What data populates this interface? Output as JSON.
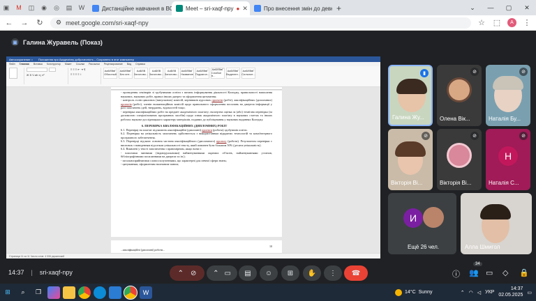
{
  "browser": {
    "tabs": [
      {
        "label": "Дистанційне навчання в ВСП",
        "favicon_color": "#4285f4"
      },
      {
        "label": "Meet – sri-xaqf-npy",
        "favicon_color": "#00897b",
        "active": true
      },
      {
        "label": "Про внесення змін до девки",
        "favicon_color": "#4285f4"
      }
    ],
    "url": "meet.google.com/sri-xaqf-npy",
    "profile_initial": "A"
  },
  "meet": {
    "presenter_label": "Галина Журавель (Показ)",
    "meeting_time": "14:37",
    "meeting_code": "sri-xaqf-npy",
    "participant_count": "34",
    "more_participants": "Ещё 26 чел.",
    "participants": [
      {
        "name": "Галина Жу...",
        "bg": "#c8d6c0",
        "speaking": true
      },
      {
        "name": "Олена Вік...",
        "bg": "#3a3a3a",
        "speaking": false
      },
      {
        "name": "Наталія Бу...",
        "bg": "#7aa0b0",
        "speaking": false
      },
      {
        "name": "Вікторія Ві...",
        "bg": "#c9bba8",
        "speaking": false
      },
      {
        "name": "Вікторія Ві...",
        "bg": "#7a4a4a",
        "speaking": false
      },
      {
        "name": "Наталія С...",
        "bg": "#a01b57",
        "letter": "Н",
        "speaking": false
      },
      {
        "name": "Алла Шмигол",
        "bg": "#d8d4cf",
        "speaking": false
      }
    ],
    "more_letter": "И"
  },
  "document": {
    "word_title": "Положення про Академічну доброчесність – Сохранено в этот компьютер",
    "ribbon_tabs": [
      "Файл",
      "Главная",
      "Вставка",
      "Конструктор",
      "Макет",
      "Ссылки",
      "Рассылки",
      "Рецензирование",
      "Вид",
      "Справка"
    ],
    "styles": [
      "АаБбВвГ",
      "АаБбВвГ",
      "АаБбВ",
      "АаБбВ",
      "АаБбВ",
      "АаБбВвГ",
      "АаБбВвГ",
      "АаБбВвГ",
      "АаБбВвГ",
      "АаБбВвГ"
    ],
    "style_names": [
      "Обычный",
      "Без инт...",
      "Заголово...",
      "Заголово...",
      "Заголово...",
      "Название",
      "Подзагол...",
      "Слабое в...",
      "Выделен...",
      "Сильное..."
    ],
    "para1": "- проведення семінарів зі здобувачами освіти з питань інформування діяльності Коледжу, правильності написання наукових, наукових робіт, правил інших джерел та оформлення цитування;",
    "para2": "- контроль голів циклових (випускових) комісій, керівників курсових",
    "para2_hl1": "проектів",
    "para2_mid": "(робіт), кваліфікаційних (дипломних)",
    "para2_hl2": "проектів",
    "para2_end": "(робіт), членів екзаменаційних комісій щодо правильного оформлення посилань на джерела інформації у разі запозичень ідей, тверджень, відомостей тощо;",
    "para3": "- перевірка кваліфікаційних робіт на предмет академічного плагіату; експертна оцінка за (або) технічна перевірка (за допомогою спеціалізованих програмних засобів) щодо ознак академічного плагіату в наукових статтях та інших роботах науково-дослідницького характеру матеріалів, поданих до публікування у наукових виданнях Коледжу.",
    "heading": "6. ПЕРЕВІРКА КВАЛІФІКАЦІЙНИХ (ДИПЛОМНИХ) РОБІТ",
    "p61a": "6.1. Перевірці на плагіат підлягають кваліфікаційні (дипломні)",
    "p61hl": "проекти",
    "p61b": "(роботи) здобувачів освіти.",
    "p62": "6.2. Перевірка на унікальність запозичень здійснюється з використанням відкритих технологій та комп'ютерного програмного забезпечення.",
    "p63a": "6.3. Перевірці підлягає основна частина кваліфікаційного (дипломного)",
    "p63hl": "проекту",
    "p63b": "(роботи). Результатом перевірки є висновок з наведенням відсотком унікальності тексту, який повинен бути більшим 50% (десяти унікальність).",
    "p64": "6.4. Виявлені у тексті запозичення з правомірним, якщо вони є:",
    "p64a": "- власними чинними (індивідуальними) найменуваннями окремих об'єктів, найменуваннями установ, бібліографічними посиланнями на джерела та ін.);",
    "p64b": "- загальноприйнятими словосполученнями, що характерні для певної сфери знань;",
    "p64c": "- цитуванням, оформленим належним чином;",
    "page_number": "10",
    "page2_text": "...кваліфікаційні (дипломні) роботи...",
    "status_left": "Страница 11 из 11   Число слов: 4 006   украинский"
  },
  "taskbar": {
    "weather_temp": "14°C",
    "weather_text": "Sunny",
    "lang": "УКР",
    "time": "14:37",
    "date": "02.05.2025"
  }
}
